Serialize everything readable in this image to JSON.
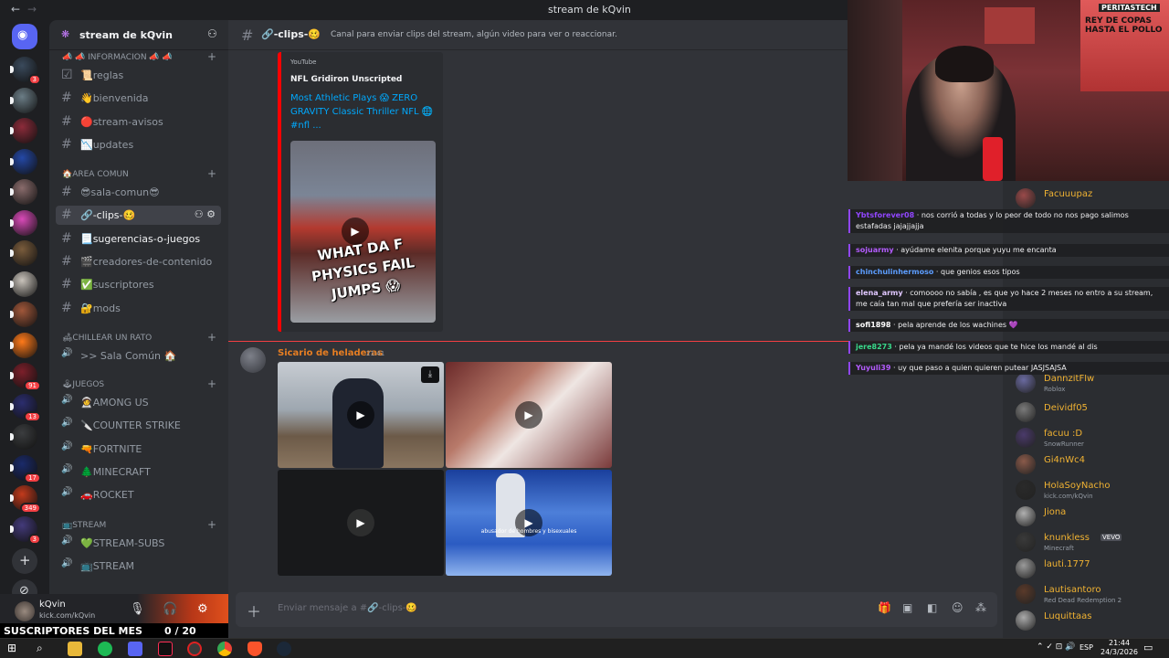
{
  "window": {
    "title": "stream de kQvin"
  },
  "server": {
    "name": "stream de kQvin"
  },
  "server_rail": {
    "items": [
      {
        "name": "server-1",
        "badge": "3",
        "color": "#3a4a5c"
      },
      {
        "name": "server-2",
        "badge": "",
        "color": "#6b7d86"
      },
      {
        "name": "server-3",
        "badge": "",
        "color": "#8c2b3a"
      },
      {
        "name": "server-4",
        "badge": "",
        "color": "#2448a6"
      },
      {
        "name": "server-5",
        "badge": "",
        "color": "#8a6c6c"
      },
      {
        "name": "server-6",
        "badge": "",
        "color": "#d94ab8"
      },
      {
        "name": "server-7",
        "badge": "",
        "color": "#7a5c3c"
      },
      {
        "name": "server-8",
        "badge": "",
        "color": "#c9c3bb"
      },
      {
        "name": "server-9",
        "badge": "",
        "color": "#a0573a"
      },
      {
        "name": "server-10",
        "badge": "",
        "color": "#ff7a1a"
      },
      {
        "name": "server-11",
        "badge": "91",
        "color": "#7c1f2a"
      },
      {
        "name": "server-12",
        "badge": "13",
        "color": "#2b2d6e"
      },
      {
        "name": "server-13",
        "badge": "",
        "color": "#3b3d3f"
      },
      {
        "name": "server-14",
        "badge": "17",
        "color": "#1a2a6a"
      },
      {
        "name": "server-15",
        "badge": "349",
        "color": "#c23a1c"
      },
      {
        "name": "server-16",
        "badge": "3",
        "color": "#433a7a"
      }
    ]
  },
  "sidebar": {
    "categories": [
      {
        "label": "📣 📣 INFORMACION 📣 📣",
        "channels": [
          {
            "label": "📜reglas",
            "icon": "☑",
            "state": ""
          },
          {
            "label": "👋bienvenida",
            "icon": "#",
            "state": ""
          },
          {
            "label": "🔴stream-avisos",
            "icon": "#",
            "state": ""
          },
          {
            "label": "📉updates",
            "icon": "#",
            "state": ""
          }
        ]
      },
      {
        "label": "🏠AREA COMUN",
        "channels": [
          {
            "label": "😎sala-comun😎",
            "icon": "#",
            "state": ""
          },
          {
            "label": "🔗-clips-🥴",
            "icon": "#",
            "state": "active"
          },
          {
            "label": "📃sugerencias-o-juegos",
            "icon": "#",
            "state": "unread"
          },
          {
            "label": "🎬creadores-de-contenido",
            "icon": "#",
            "state": ""
          },
          {
            "label": "✅suscriptores",
            "icon": "#",
            "state": ""
          },
          {
            "label": "🔐mods",
            "icon": "#",
            "state": ""
          }
        ]
      },
      {
        "label": "🛋CHILLEAR UN RATO",
        "channels": [
          {
            "label": ">> Sala Común 🏠",
            "icon": "🔊",
            "state": ""
          }
        ]
      },
      {
        "label": "🕹JUEGOS",
        "channels": [
          {
            "label": "🧑‍🚀AMONG US",
            "icon": "🔊",
            "state": ""
          },
          {
            "label": "🔪COUNTER STRIKE",
            "icon": "🔊",
            "state": ""
          },
          {
            "label": "🔫FORTNITE",
            "icon": "🔊",
            "state": ""
          },
          {
            "label": "🌲MINECRAFT",
            "icon": "🔊",
            "state": ""
          },
          {
            "label": "🚗ROCKET",
            "icon": "🔊",
            "state": ""
          }
        ]
      },
      {
        "label": "📺STREAM",
        "channels": [
          {
            "label": "💚STREAM-SUBS",
            "icon": "🔊",
            "state": ""
          },
          {
            "label": "📺STREAM",
            "icon": "🔊",
            "state": ""
          }
        ]
      }
    ]
  },
  "user_panel": {
    "username": "kQvin",
    "status": "kick.com/kQvin"
  },
  "subs_bar": {
    "label": "SUSCRIPTORES DEL MES",
    "count": "0 / 20"
  },
  "channel": {
    "name": "🔗-clips-🥴",
    "topic": "Canal para enviar clips del stream, algún video para ver o reaccionar.",
    "composer_placeholder": "Enviar mensaje a #🔗-clips-🥴"
  },
  "embed": {
    "provider": "YouTube",
    "author": "NFL Gridiron Unscripted",
    "title": "Most Athletic Plays 😱 ZERO GRAVITY Classic Thriller NFL 🌐 #nfl ...",
    "thumbnail_text": "WHAT DA F PHYSICS FAIL JUMPS 😱"
  },
  "message": {
    "author": "Sicario de heladeras",
    "time": "21:41",
    "videos": [
      {
        "name": "video-1",
        "caption": ""
      },
      {
        "name": "video-2",
        "caption": ""
      },
      {
        "name": "video-3",
        "caption": ""
      },
      {
        "name": "video-4",
        "caption": "abusador de hombres y bisexuales"
      }
    ]
  },
  "members": [
    {
      "name": "Facuuupaz",
      "status": "",
      "tag": ""
    },
    {
      "name": "DannzitFlw",
      "status": "Roblox",
      "tag": ""
    },
    {
      "name": "Deividf05",
      "status": "",
      "tag": ""
    },
    {
      "name": "facuu :D",
      "status": "SnowRunner",
      "tag": ""
    },
    {
      "name": "Gi4nWc4",
      "status": "",
      "tag": ""
    },
    {
      "name": "HolaSoyNacho",
      "status": "kick.com/kQvin",
      "tag": ""
    },
    {
      "name": "Jiona",
      "status": "",
      "tag": ""
    },
    {
      "name": "knunkless",
      "status": "Minecraft",
      "tag": "VEVO"
    },
    {
      "name": "lauti.1777",
      "status": "",
      "tag": ""
    },
    {
      "name": "Lautisantoro",
      "status": "Red Dead Redemption 2",
      "tag": ""
    },
    {
      "name": "Luquittaas",
      "status": "",
      "tag": ""
    }
  ],
  "stream_chat": [
    {
      "user": "Ybtsforever08",
      "color": "#9146ff",
      "text": "nos corrió a todas y lo peor de todo no nos pago salimos estafadas jajajjajja"
    },
    {
      "user": "sojuarmy",
      "color": "#b45cff",
      "text": "ayúdame elenita porque yuyu me encanta"
    },
    {
      "user": "chinchulinhermoso",
      "color": "#5c9dff",
      "text": "que genios esos tipos"
    },
    {
      "user": "elena_army",
      "color": "#e0c7ff",
      "text": "comoooo no sabía , es que yo hace 2 meses no entro a su stream, me caía tan mal que prefería ser inactiva"
    },
    {
      "user": "sofi1898",
      "color": "#ffffff",
      "text": "pela aprende de los wachines 💜"
    },
    {
      "user": "jere8273",
      "color": "#39d98a",
      "text": "pela ya mandé los videos que te hice los mandé al dis"
    },
    {
      "user": "Yuyuli39",
      "color": "#b45cff",
      "text": "uy que paso a quien quieren putear JASJSAJSA"
    }
  ],
  "webcam": {
    "poster_brand": "PERITASTECH",
    "poster_text": "REY DE COPAS HASTA EL POLLO"
  },
  "taskbar": {
    "lang": "ESP",
    "time": "21:44",
    "date": "24/3/2026"
  }
}
